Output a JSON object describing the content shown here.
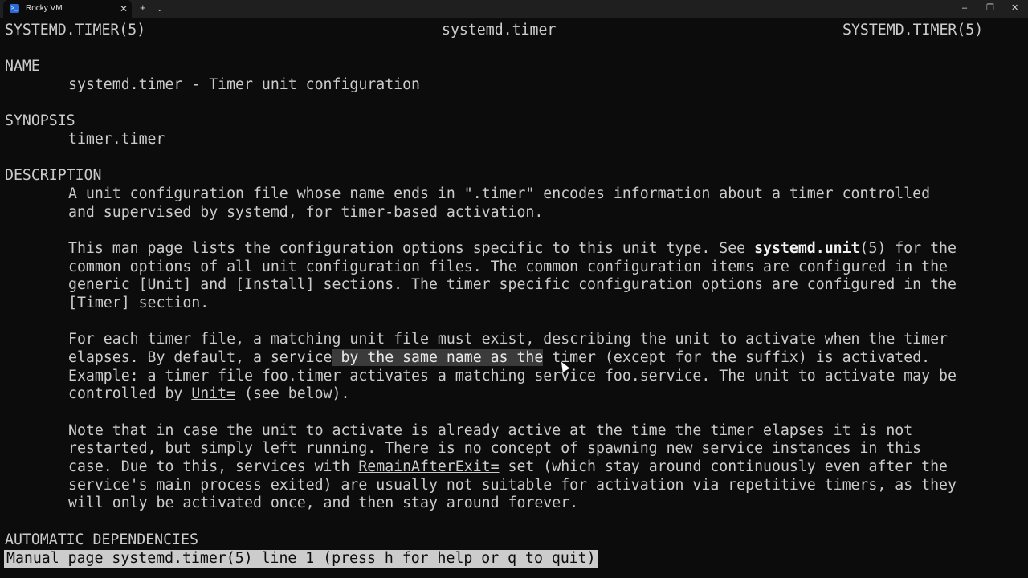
{
  "window": {
    "tab_title": "Rocky VM",
    "tab_icon": "terminal-icon",
    "new_tab": "+",
    "dropdown": "⌄",
    "close_tab": "✕",
    "minimize": "–",
    "maximize": "❐",
    "close": "✕"
  },
  "man": {
    "header_left": "SYSTEMD.TIMER(5)",
    "header_center": "systemd.timer",
    "header_right": "SYSTEMD.TIMER(5)",
    "name_heading": "NAME",
    "name_text": "systemd.timer - Timer unit configuration",
    "synopsis_heading": "SYNOPSIS",
    "synopsis_u": "timer",
    "synopsis_rest": ".timer",
    "description_heading": "DESCRIPTION",
    "p1_l1": "A unit configuration file whose name ends in \".timer\" encodes information about a timer controlled",
    "p1_l2": "and supervised by systemd, for timer-based activation.",
    "p2_l1a": "This man page lists the configuration options specific to this unit type. See ",
    "p2_l1b": "systemd.unit",
    "p2_l1c": "(5) for the",
    "p2_l2": "common options of all unit configuration files. The common configuration items are configured in the",
    "p2_l3": "generic [Unit] and [Install] sections. The timer specific configuration options are configured in the",
    "p2_l4": "[Timer] section.",
    "p3_l1": "For each timer file, a matching unit file must exist, describing the unit to activate when the timer",
    "p3_l2a": "elapses. By default, a service",
    "p3_l2sel": " by the same name as the",
    "p3_l2c": " timer (except for the suffix) is activated.",
    "p3_l3": "Example: a timer file foo.timer activates a matching service foo.service. The unit to activate may be",
    "p3_l4a": "controlled by ",
    "p3_l4u": "Unit=",
    "p3_l4c": " (see below).",
    "p4_l1": "Note that in case the unit to activate is already active at the time the timer elapses it is not",
    "p4_l2": "restarted, but simply left running. There is no concept of spawning new service instances in this",
    "p4_l3a": "case. Due to this, services with ",
    "p4_l3u": "RemainAfterExit=",
    "p4_l3c": " set (which stay around continuously even after the",
    "p4_l4": "service's main process exited) are usually not suitable for activation via repetitive timers, as they",
    "p4_l5": "will only be activated once, and then stay around forever.",
    "auto_heading": "AUTOMATIC DEPENDENCIES",
    "status_bar": "Manual page systemd.timer(5) line 1 (press h for help or q to quit)"
  }
}
